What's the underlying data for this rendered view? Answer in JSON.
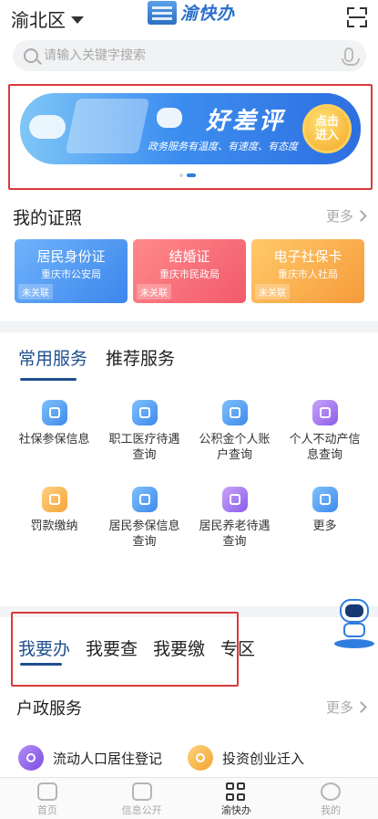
{
  "header": {
    "location": "渝北区",
    "logo_text": "渝快办",
    "search_placeholder": "请输入关键字搜索"
  },
  "banner": {
    "title": "好差评",
    "subtitle": "政务服务有温度、有速度、有态度",
    "button_line1": "点击",
    "button_line2": "进入",
    "page_index": 2,
    "page_count": 2
  },
  "licenses": {
    "title": "我的证照",
    "more": "更多",
    "cards": [
      {
        "name": "居民身份证",
        "issuer": "重庆市公安局",
        "status": "未关联",
        "color": "#4a90ee"
      },
      {
        "name": "结婚证",
        "issuer": "重庆市民政局",
        "status": "未关联",
        "color": "#f4606e"
      },
      {
        "name": "电子社保卡",
        "issuer": "重庆市人社局",
        "status": "未关联",
        "color": "#f7a440"
      }
    ]
  },
  "services": {
    "tabs": [
      "常用服务",
      "推荐服务"
    ],
    "items": [
      {
        "label": "社保参保信息",
        "icon": "shield-s-icon"
      },
      {
        "label": "职工医疗待遇查询",
        "icon": "id-card-icon"
      },
      {
        "label": "公积金个人账户查询",
        "icon": "wallet-icon"
      },
      {
        "label": "个人不动产信息查询",
        "icon": "person-doc-icon"
      },
      {
        "label": "罚款缴纳",
        "icon": "receipt-icon"
      },
      {
        "label": "居民参保信息查询",
        "icon": "shield-icon"
      },
      {
        "label": "居民养老待遇查询",
        "icon": "pension-doc-icon"
      },
      {
        "label": "更多",
        "icon": "grid-more-icon"
      }
    ]
  },
  "lower_tabs": {
    "tabs": [
      "我要办",
      "我要查",
      "我要缴",
      "专区"
    ],
    "section_title": "户政服务",
    "more": "更多",
    "items": [
      {
        "label": "流动人口居住登记",
        "icon": "people-icon"
      },
      {
        "label": "投资创业迁入",
        "icon": "chart-icon"
      }
    ]
  },
  "bottom_nav": [
    {
      "label": "首页",
      "icon": "home-icon"
    },
    {
      "label": "信息公开",
      "icon": "document-icon"
    },
    {
      "label": "渝快办",
      "icon": "grid-icon"
    },
    {
      "label": "我的",
      "icon": "user-icon"
    }
  ],
  "colors": {
    "accent": "#1f4f8e",
    "highlight_box": "#d93a3a",
    "banner_blue": "#2e6fe0"
  }
}
